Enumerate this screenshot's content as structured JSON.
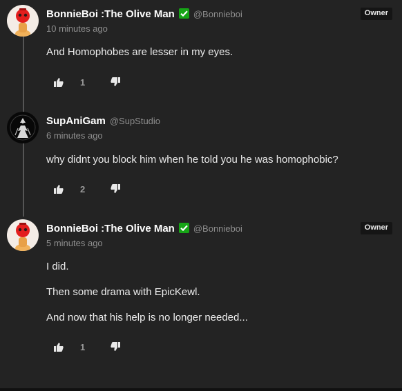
{
  "comments": [
    {
      "name": "BonnieBoi :The Olive Man",
      "handle": "@Bonnieboi",
      "time": "10 minutes ago",
      "badge": "Owner",
      "lines": [
        "And Homophobes are lesser in my eyes."
      ],
      "likes": "1",
      "avatar": "olive-robot-avatar"
    },
    {
      "name": "SupAniGam",
      "handle": "@SupStudio",
      "time": "6 minutes ago",
      "badge": "",
      "lines": [
        "why didnt you block him when he told you he was homophobic?"
      ],
      "likes": "2",
      "avatar": "dark-figure-avatar"
    },
    {
      "name": "BonnieBoi :The Olive Man",
      "handle": "@Bonnieboi",
      "time": "5 minutes ago",
      "badge": "Owner",
      "lines": [
        "I did.",
        "Then some drama with EpicKewl.",
        "And now that his help is no longer needed..."
      ],
      "likes": "1",
      "avatar": "olive-robot-avatar"
    }
  ],
  "colors": {
    "background": "#232323",
    "verified": "#16a516",
    "muted": "#8e8e8e"
  },
  "icons": [
    "verified-check-icon",
    "thumbs-up-icon",
    "thumbs-down-icon"
  ]
}
